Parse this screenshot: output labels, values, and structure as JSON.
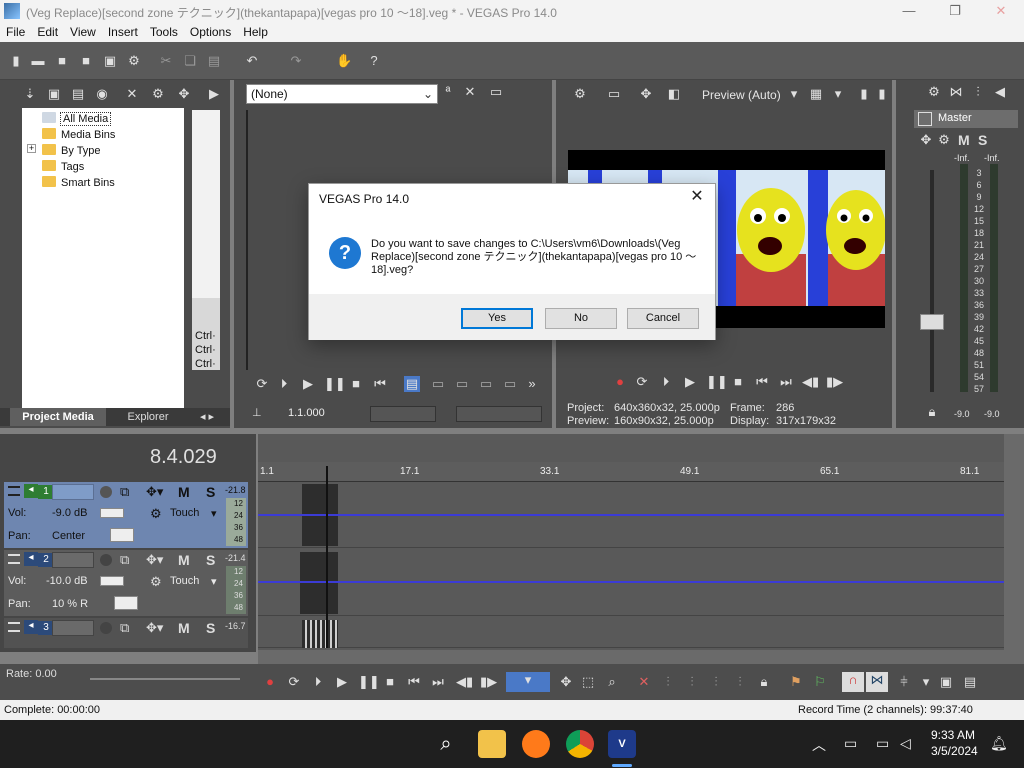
{
  "window": {
    "title": "(Veg Replace)[second zone テクニック](thekantapapa)[vegas pro 10 ～18].veg * - VEGAS Pro 14.0",
    "minimize": "—",
    "maximize": "❐",
    "close": "✕"
  },
  "menu": [
    "File",
    "Edit",
    "View",
    "Insert",
    "Tools",
    "Options",
    "Help"
  ],
  "media_tree": {
    "items": [
      {
        "label": "All Media",
        "selected": true
      },
      {
        "label": "Media Bins"
      },
      {
        "label": "By Type",
        "expand": "+"
      },
      {
        "label": "Tags"
      },
      {
        "label": "Smart Bins"
      }
    ],
    "tabs": [
      "Project Media",
      "Explorer"
    ]
  },
  "trimmer": {
    "preset": "(None)",
    "ctrl_labels": [
      "Ctrl·",
      "Ctrl·",
      "Ctrl·"
    ],
    "timecode": "1.1.000"
  },
  "preview": {
    "quality": "Preview (Auto)",
    "project_label": "Project:",
    "project_value": "640x360x32, 25.000p",
    "preview_label": "Preview:",
    "preview_value": "160x90x32, 25.000p",
    "frame_label": "Frame:",
    "frame_value": "286",
    "display_label": "Display:",
    "display_value": "317x179x32"
  },
  "mixer": {
    "master_label": "Master",
    "m_label": "M",
    "s_label": "S",
    "inf_left": "-Inf.",
    "inf_right": "-Inf.",
    "scale": [
      "3",
      "6",
      "9",
      "12",
      "15",
      "18",
      "21",
      "24",
      "27",
      "30",
      "33",
      "36",
      "39",
      "42",
      "45",
      "48",
      "51",
      "54",
      "57"
    ],
    "bottom_left": "-9.0",
    "bottom_right": "-9.0"
  },
  "timeline": {
    "cursor_time": "8.4.029",
    "ruler": [
      "1.1",
      "17.1",
      "33.1",
      "49.1",
      "65.1",
      "81.1"
    ],
    "tracks": [
      {
        "num": "1",
        "vol_label": "Vol:",
        "vol": "-9.0 dB",
        "pan_label": "Pan:",
        "pan": "Center",
        "mode": "Touch",
        "meter": "-21.8",
        "m": "M",
        "s": "S"
      },
      {
        "num": "2",
        "vol_label": "Vol:",
        "vol": "-10.0 dB",
        "pan_label": "Pan:",
        "pan": "10 % R",
        "mode": "Touch",
        "meter": "-21.4",
        "m": "M",
        "s": "S"
      },
      {
        "num": "3",
        "meter": "-16.7",
        "m": "M",
        "s": "S"
      }
    ],
    "meter_ticks": [
      "12",
      "24",
      "36",
      "48"
    ],
    "rate_label": "Rate: 0.00"
  },
  "status": {
    "left": "Complete: 00:00:00",
    "right": "Record Time (2 channels): 99:37:40"
  },
  "dialog": {
    "title": "VEGAS Pro 14.0",
    "close": "✕",
    "icon": "?",
    "message": "Do you want to save changes to C:\\Users\\vm6\\Downloads\\(Veg Replace)[second zone テクニック](thekantapapa)[vegas pro 10 ～18].veg?",
    "yes": "Yes",
    "no": "No",
    "cancel": "Cancel"
  },
  "taskbar": {
    "time": "9:33 AM",
    "date": "3/5/2024"
  },
  "colors": {
    "dialog_icon": "#1e78d2",
    "track_selected": "#6e86b0",
    "envelope": "#3b3bd6"
  }
}
